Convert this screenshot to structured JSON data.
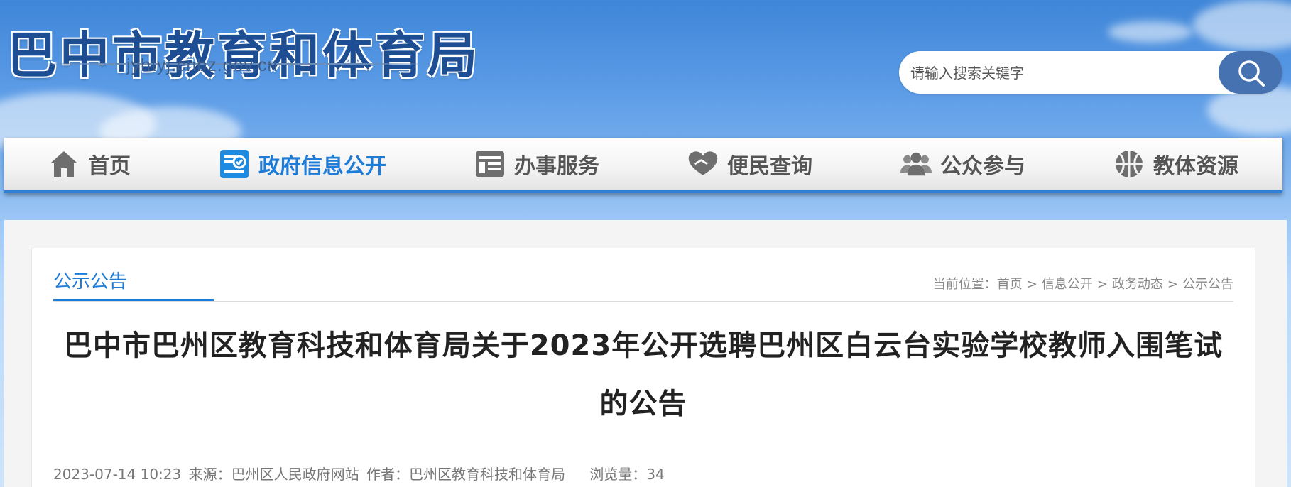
{
  "header": {
    "site_title": "巴中市教育和体育局",
    "site_domain": "jyhtyj.cnbz.gov.cn",
    "search": {
      "placeholder": "请输入搜索关键字",
      "button_icon": "search-icon"
    }
  },
  "nav": {
    "active_color": "#1e7cd6",
    "items": [
      {
        "label": "首页",
        "icon": "home-icon"
      },
      {
        "label": "政府信息公开",
        "icon": "checklist-icon",
        "active": true
      },
      {
        "label": "办事服务",
        "icon": "service-card-icon"
      },
      {
        "label": "便民查询",
        "icon": "heart-hand-icon"
      },
      {
        "label": "公众参与",
        "icon": "people-icon"
      },
      {
        "label": "教体资源",
        "icon": "basketball-icon"
      }
    ]
  },
  "section": {
    "title": "公示公告",
    "breadcrumb": {
      "prefix": "当前位置：",
      "items": [
        "首页",
        "信息公开",
        "政务动态",
        "公示公告"
      ],
      "separator": ">"
    }
  },
  "article": {
    "title": "巴中市巴州区教育科技和体育局关于2023年公开选聘巴州区白云台实验学校教师入围笔试的公告",
    "date": "2023-07-14 10:23",
    "source_label": "来源：",
    "source": "巴州区人民政府网站",
    "author_label": "作者：",
    "author": "巴州区教育科技和体育局",
    "views_label": "浏览量：",
    "views": "34"
  }
}
